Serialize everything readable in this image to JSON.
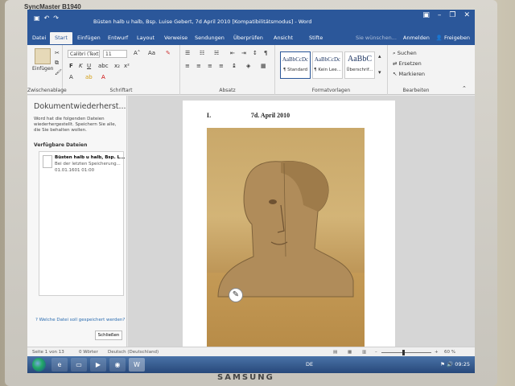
{
  "monitor": {
    "model": "SyncMaster B1940",
    "brand": "SAMSUNG"
  },
  "window": {
    "title": "Büsten halb u halb, Bsp. Luise Gebert, 7d April 2010 [Kompatibilitätsmodus] - Word",
    "qa_icons": [
      "save-icon",
      "undo-icon",
      "redo-icon"
    ]
  },
  "tabs": {
    "items": [
      "Datei",
      "Start",
      "Einfügen",
      "Entwurf",
      "Layout",
      "Verweise",
      "Sendungen",
      "Überprüfen",
      "Ansicht",
      "Stifte"
    ],
    "active": "Start",
    "search": "Sie wünschen...",
    "signin": "Anmelden",
    "share": "Freigeben"
  },
  "ribbon": {
    "clipboard": {
      "paste": "Einfügen",
      "label": "Zwischenablage"
    },
    "font": {
      "name": "Calibri (Textk",
      "size": "11",
      "label": "Schriftart",
      "bold": "F",
      "italic": "K",
      "underline": "U"
    },
    "paragraph": {
      "label": "Absatz"
    },
    "styles": {
      "label": "Formatvorlagen",
      "items": [
        {
          "sample": "AaBbCcDc",
          "name": "¶ Standard"
        },
        {
          "sample": "AaBbCcDc",
          "name": "¶ Kein Lee..."
        },
        {
          "sample": "AaBbC",
          "name": "Überschrif..."
        }
      ]
    },
    "editing": {
      "label": "Bearbeiten",
      "find": "Suchen",
      "replace": "Ersetzen",
      "select": "Markieren"
    }
  },
  "recovery": {
    "title": "Dokumentwiederherst...",
    "description": "Word hat die folgenden Dateien wiederhergestellt. Speichern Sie alle, die Sie behalten wollen.",
    "subtitle": "Verfügbare Dateien",
    "entry": {
      "name": "Büsten halb u halb, Bsp. L...",
      "status": "Bei der letzten Speicherung...",
      "date": "01.01.1601 01:00"
    },
    "help": "Welche Datei soll gespeichert werden?",
    "close": "Schließen"
  },
  "document": {
    "heading_left": "L",
    "heading_right": "7d. April 2010"
  },
  "status": {
    "page": "Seite 1 von 13",
    "words": "0 Wörter",
    "language": "Deutsch (Deutschland)",
    "zoom": "60 %"
  },
  "taskbar": {
    "lang": "DE",
    "time": "09:25",
    "apps": [
      "explorer-icon",
      "folder-icon",
      "media-icon",
      "firefox-icon",
      "word-icon"
    ]
  }
}
